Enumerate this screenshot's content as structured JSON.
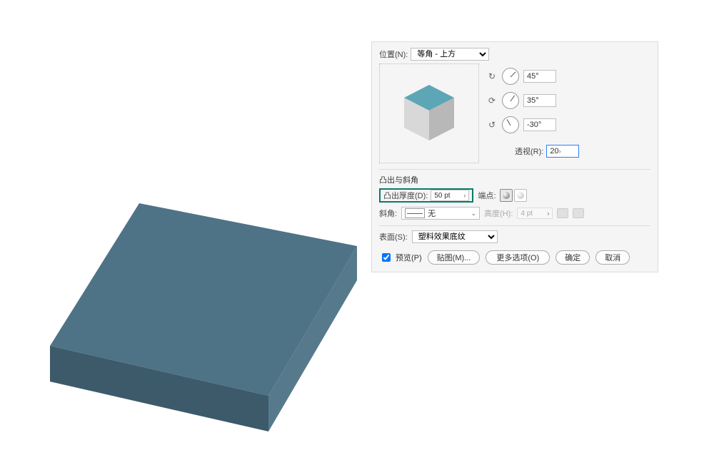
{
  "dialog": {
    "position_label": "位置(N):",
    "position_value": "等角 - 上方",
    "rot_x": "45°",
    "rot_y": "35°",
    "rot_z": "-30°",
    "perspective_label": "透视(R):",
    "perspective_value": "20",
    "extrude_section": "凸出与斜角",
    "extrude_depth_label": "凸出厚度(D):",
    "extrude_depth_value": "50 pt",
    "cap_label": "端点:",
    "bevel_label": "斜角:",
    "bevel_value": "无",
    "height_label": "高度(H):",
    "height_value": "4 pt",
    "surface_label": "表面(S):",
    "surface_value": "塑料效果底纹",
    "preview_label": "预览(P)",
    "map_btn": "贴图(M)...",
    "more_btn": "更多选项(O)",
    "ok_btn": "确定",
    "cancel_btn": "取消"
  }
}
